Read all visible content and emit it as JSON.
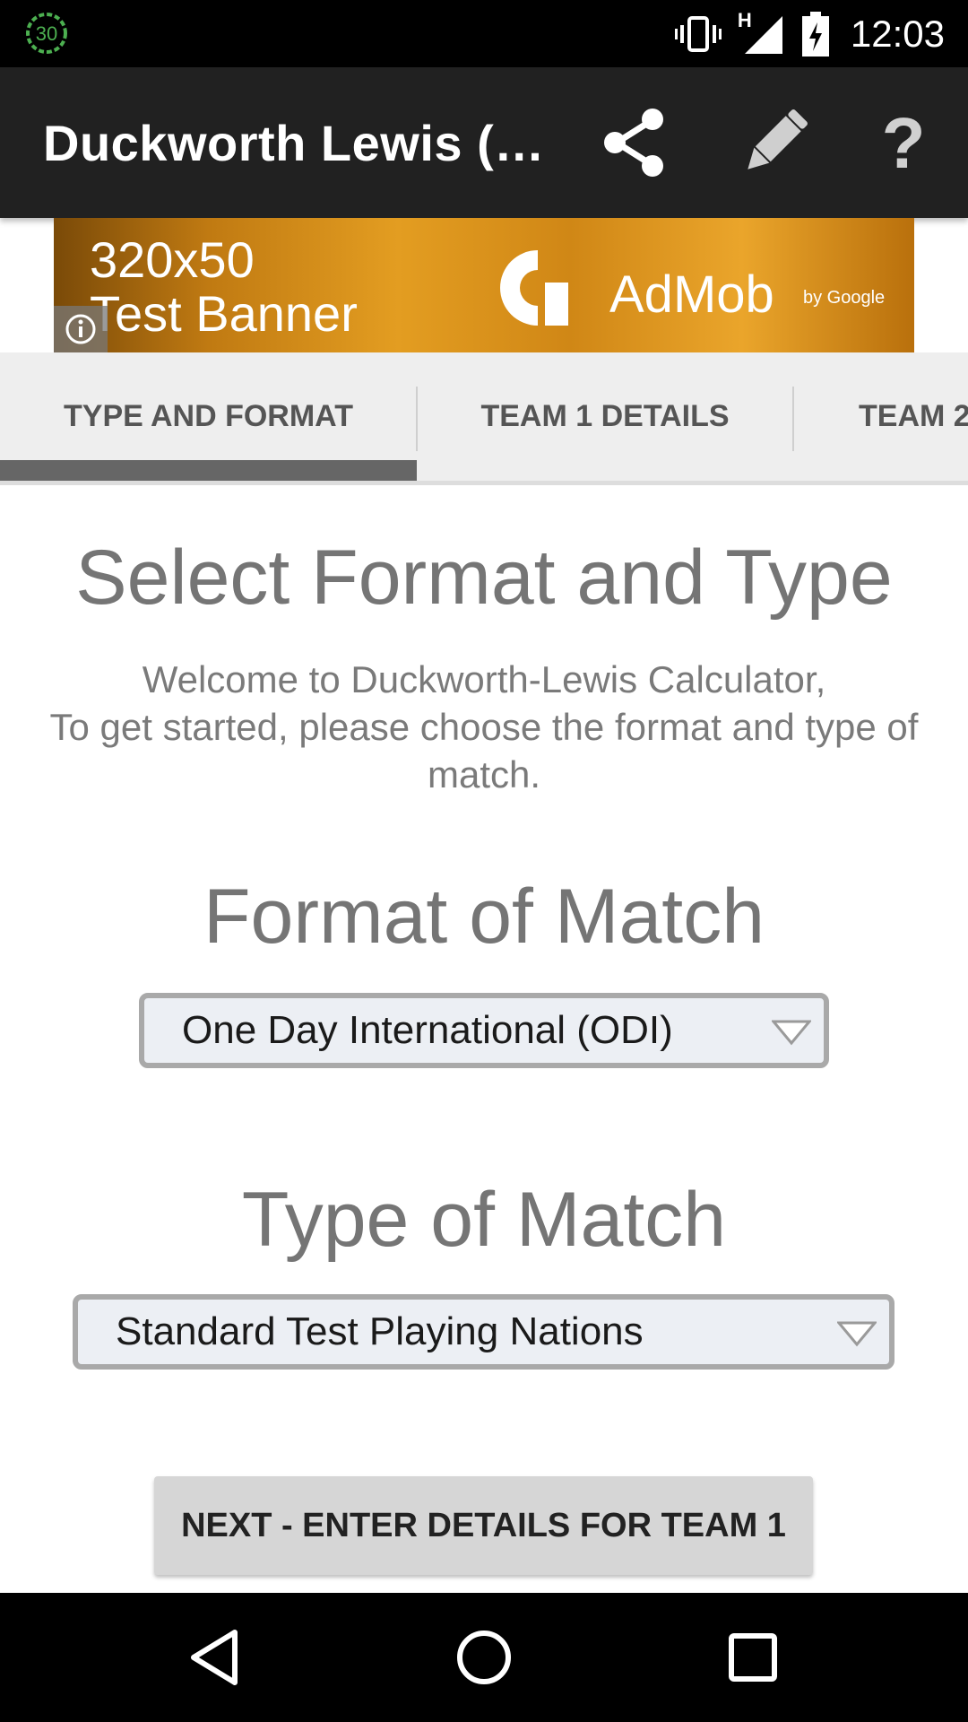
{
  "status_bar": {
    "notification_badge": "30",
    "network": "H",
    "time": "12:03"
  },
  "app_bar": {
    "title": "Duckworth Lewis (…",
    "actions": [
      "share-icon",
      "edit-pencil-icon",
      "help-icon"
    ]
  },
  "ad": {
    "line1": "320x50",
    "line2": "Test Banner",
    "brand": "AdMob",
    "brand_sub": "by Google"
  },
  "tabs": [
    {
      "label": "TYPE AND FORMAT",
      "selected": true
    },
    {
      "label": "TEAM 1 DETAILS",
      "selected": false
    },
    {
      "label": "TEAM 2",
      "selected": false
    }
  ],
  "content": {
    "heading": "Select Format and Type",
    "welcome_line1": "Welcome to Duckworth-Lewis Calculator,",
    "welcome_line2": "To get started, please choose the format and type of match.",
    "format_heading": "Format of Match",
    "format_value": "One Day International (ODI)",
    "type_heading": "Type of Match",
    "type_value": "Standard Test Playing Nations",
    "next_button": "NEXT - ENTER DETAILS FOR TEAM 1"
  },
  "colors": {
    "app_bar": "#212121",
    "tab_indicator": "#666666",
    "heading_text": "#757575"
  }
}
